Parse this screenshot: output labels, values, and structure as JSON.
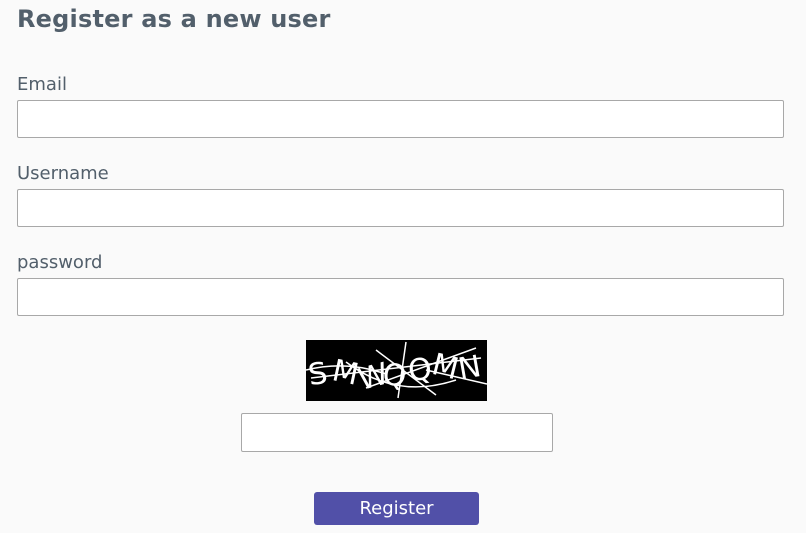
{
  "page": {
    "title": "Register as a new user"
  },
  "form": {
    "email_label": "Email",
    "email_value": "",
    "username_label": "Username",
    "username_value": "",
    "password_label": "password",
    "password_value": "",
    "captcha_value": "",
    "register_label": "Register"
  },
  "captcha": {
    "text": "SMWQQMN",
    "background_color": "#000000",
    "text_color": "#ffffff"
  },
  "colors": {
    "text": "#525f6b",
    "button": "#5150a8",
    "background": "#fafafa"
  }
}
